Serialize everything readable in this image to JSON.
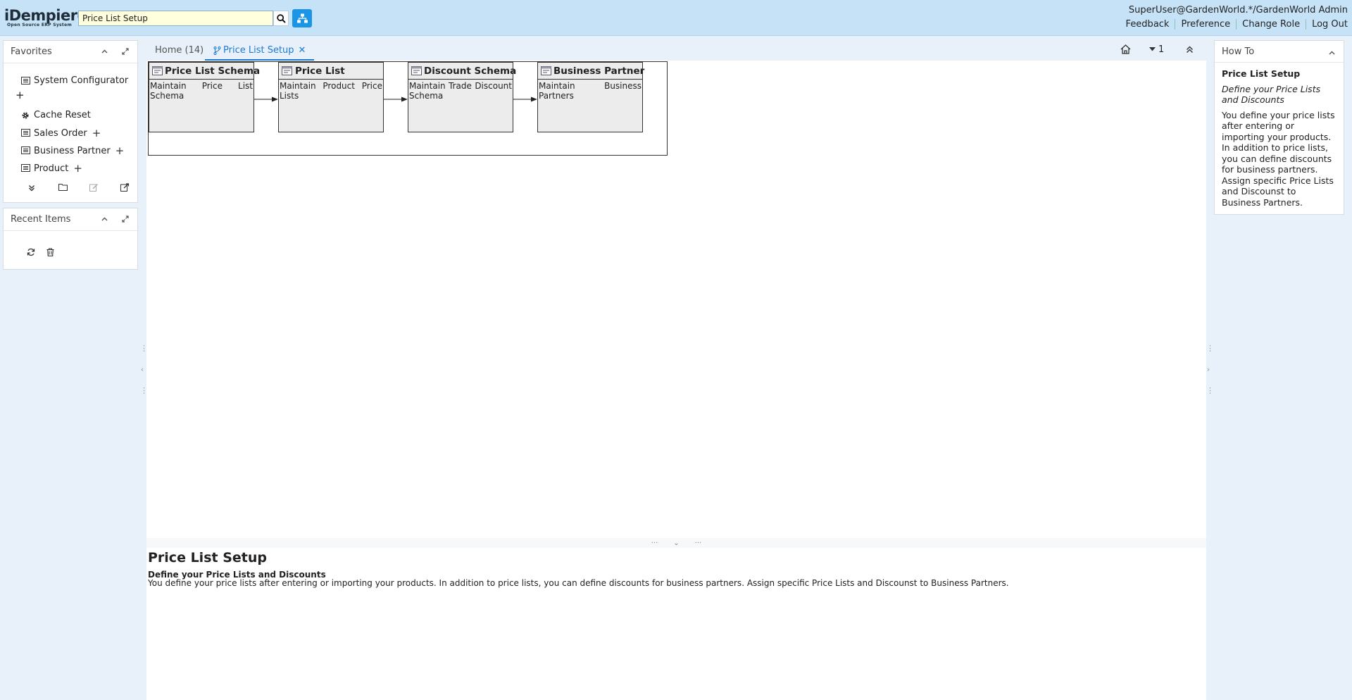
{
  "header": {
    "logo_main": "iDempiere",
    "logo_sub": "Open Source ERP System",
    "search_value": "Price List Setup",
    "user": "SuperUser@GardenWorld.*/GardenWorld Admin",
    "links": [
      "Feedback",
      "Preference",
      "Change Role",
      "Log Out"
    ]
  },
  "favorites": {
    "title": "Favorites",
    "items": [
      {
        "label": "System Configurator",
        "icon": "window-icon",
        "plus": false
      },
      {
        "label": "Cache Reset",
        "icon": "gear-icon",
        "plus": false
      },
      {
        "label": "Sales Order",
        "icon": "window-icon",
        "plus": true
      },
      {
        "label": "Business Partner",
        "icon": "window-icon",
        "plus": true
      },
      {
        "label": "Product",
        "icon": "window-icon",
        "plus": true
      }
    ],
    "plus_symbol": "+"
  },
  "recent": {
    "title": "Recent Items"
  },
  "tabs": {
    "home": "Home (14)",
    "active": "Price List Setup",
    "counter": "1"
  },
  "workflow": {
    "nodes": [
      {
        "title": "Price List Schema",
        "desc": "Maintain Price List Schema"
      },
      {
        "title": "Price List",
        "desc": "Maintain Product Price Lists"
      },
      {
        "title": "Discount Schema",
        "desc": "Maintain Trade Discount Schema"
      },
      {
        "title": "Business Partner",
        "desc": "Maintain Business Partners"
      }
    ]
  },
  "description": {
    "title": "Price List Setup",
    "subtitle": "Define your Price Lists and Discounts",
    "text": "You define your price lists after entering or importing your products. In addition to price lists, you can define discounts for business partners. Assign specific Price Lists and Discounst to Business Partners."
  },
  "howto": {
    "title": "How To",
    "heading": "Price List Setup",
    "subheading": "Define your Price Lists and Discounts",
    "body": "You define your price lists after entering or importing your products. In addition to price lists, you can define discounts for business partners. Assign specific Price Lists and Discounst to Business Partners."
  },
  "colors": {
    "header_bg": "#c6e2f7",
    "accent": "#1b7ad6",
    "search_bg": "#ffffdd",
    "tree_button": "#1b95e6"
  }
}
